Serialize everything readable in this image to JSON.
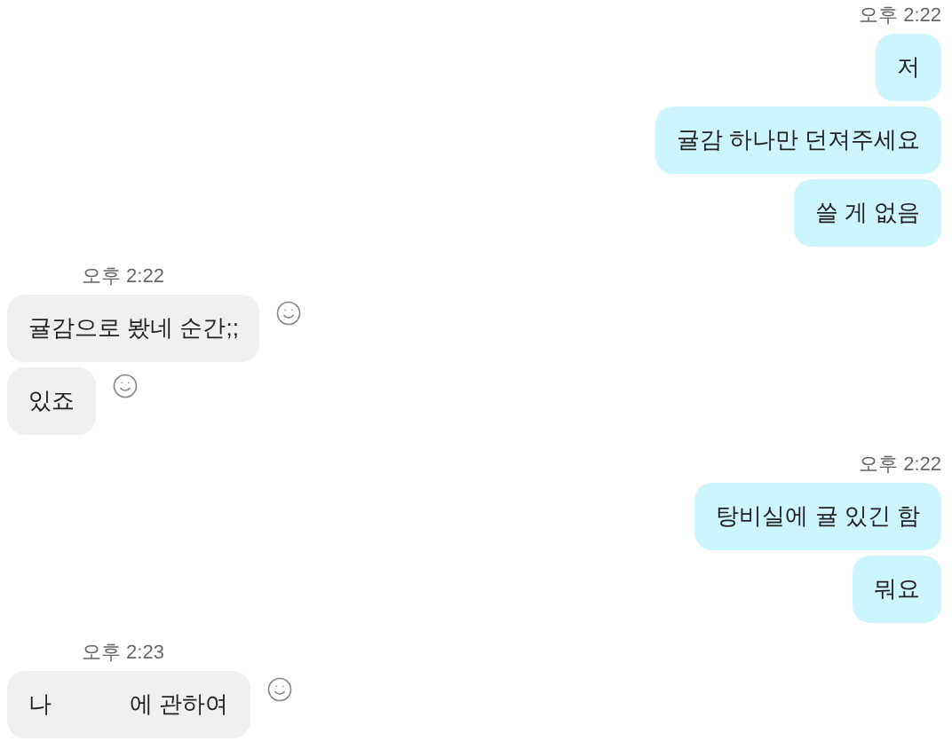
{
  "groups": [
    {
      "kind": "sent",
      "time": "오후 2:22",
      "messages": [
        {
          "parts": [
            "저"
          ]
        },
        {
          "parts": [
            "귤감 하나만 던져주세요"
          ]
        },
        {
          "parts": [
            "쓸 게 없음"
          ]
        }
      ]
    },
    {
      "kind": "received",
      "time": "오후 2:22",
      "messages": [
        {
          "parts": [
            "귤감으로 봤네 순간;;"
          ]
        },
        {
          "parts": [
            "있죠"
          ]
        }
      ]
    },
    {
      "kind": "sent",
      "time": "오후 2:22",
      "messages": [
        {
          "parts": [
            "탕비실에 귤 있긴 함"
          ]
        },
        {
          "parts": [
            "뭐요"
          ]
        }
      ]
    },
    {
      "kind": "received",
      "time": "오후 2:23",
      "messages": [
        {
          "parts": [
            "나",
            "에 관하여"
          ]
        }
      ]
    }
  ]
}
